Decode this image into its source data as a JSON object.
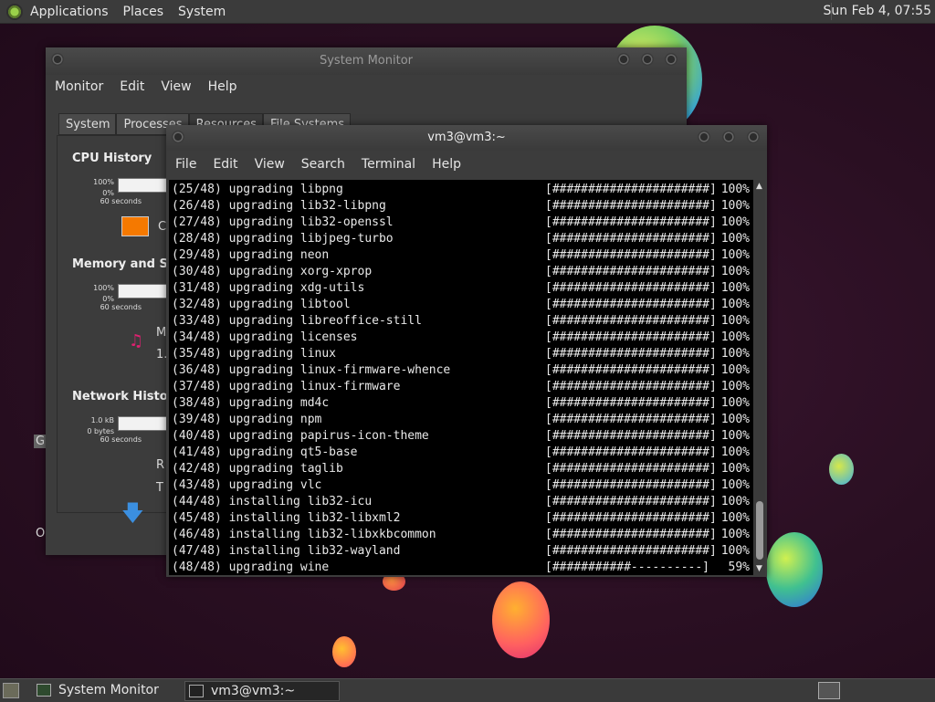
{
  "top_panel": {
    "menus": [
      "Applications",
      "Places",
      "System"
    ],
    "clock": "Sun Feb  4, 07:55"
  },
  "system_monitor": {
    "title": "System Monitor",
    "menu": [
      "Monitor",
      "Edit",
      "View",
      "Help"
    ],
    "tabs": [
      "System",
      "Processes",
      "Resources",
      "File Systems"
    ],
    "active_tab": "Resources",
    "cpu": {
      "title": "CPU History",
      "y_max": "100%",
      "y_min": "0%",
      "x": "60 seconds",
      "label_fragment": "C",
      "swatch_color": "#f57900"
    },
    "memory": {
      "title": "Memory and Swa",
      "y_max": "100%",
      "y_min": "0%",
      "x": "60 seconds",
      "label_fragment": "M",
      "value_fragment": "1."
    },
    "network": {
      "title": "Network History",
      "y_max": "1.0 kB",
      "y_min": "0 bytes",
      "x": "60 seconds",
      "label_fragment": "R",
      "value_fragment": "T"
    }
  },
  "terminal": {
    "title": "vm3@vm3:~",
    "menu": [
      "File",
      "Edit",
      "View",
      "Search",
      "Terminal",
      "Help"
    ],
    "lines": [
      {
        "text": "(25/48) upgrading libpng",
        "bar": "[######################]",
        "pct": "100%"
      },
      {
        "text": "(26/48) upgrading lib32-libpng",
        "bar": "[######################]",
        "pct": "100%"
      },
      {
        "text": "(27/48) upgrading lib32-openssl",
        "bar": "[######################]",
        "pct": "100%"
      },
      {
        "text": "(28/48) upgrading libjpeg-turbo",
        "bar": "[######################]",
        "pct": "100%"
      },
      {
        "text": "(29/48) upgrading neon",
        "bar": "[######################]",
        "pct": "100%"
      },
      {
        "text": "(30/48) upgrading xorg-xprop",
        "bar": "[######################]",
        "pct": "100%"
      },
      {
        "text": "(31/48) upgrading xdg-utils",
        "bar": "[######################]",
        "pct": "100%"
      },
      {
        "text": "(32/48) upgrading libtool",
        "bar": "[######################]",
        "pct": "100%"
      },
      {
        "text": "(33/48) upgrading libreoffice-still",
        "bar": "[######################]",
        "pct": "100%"
      },
      {
        "text": "(34/48) upgrading licenses",
        "bar": "[######################]",
        "pct": "100%"
      },
      {
        "text": "(35/48) upgrading linux",
        "bar": "[######################]",
        "pct": "100%"
      },
      {
        "text": "(36/48) upgrading linux-firmware-whence",
        "bar": "[######################]",
        "pct": "100%"
      },
      {
        "text": "(37/48) upgrading linux-firmware",
        "bar": "[######################]",
        "pct": "100%"
      },
      {
        "text": "(38/48) upgrading md4c",
        "bar": "[######################]",
        "pct": "100%"
      },
      {
        "text": "(39/48) upgrading npm",
        "bar": "[######################]",
        "pct": "100%"
      },
      {
        "text": "(40/48) upgrading papirus-icon-theme",
        "bar": "[######################]",
        "pct": "100%"
      },
      {
        "text": "(41/48) upgrading qt5-base",
        "bar": "[######################]",
        "pct": "100%"
      },
      {
        "text": "(42/48) upgrading taglib",
        "bar": "[######################]",
        "pct": "100%"
      },
      {
        "text": "(43/48) upgrading vlc",
        "bar": "[######################]",
        "pct": "100%"
      },
      {
        "text": "(44/48) installing lib32-icu",
        "bar": "[######################]",
        "pct": "100%"
      },
      {
        "text": "(45/48) installing lib32-libxml2",
        "bar": "[######################]",
        "pct": "100%"
      },
      {
        "text": "(46/48) installing lib32-libxkbcommon",
        "bar": "[######################]",
        "pct": "100%"
      },
      {
        "text": "(47/48) installing lib32-wayland",
        "bar": "[######################]",
        "pct": "100%"
      },
      {
        "text": "(48/48) upgrading wine",
        "bar": "[###########----------]",
        "pct": "59%"
      }
    ]
  },
  "taskbar": {
    "tasks": [
      "System Monitor",
      "vm3@vm3:~"
    ]
  },
  "desktop_fragments": {
    "left_letter_1": "G",
    "left_letter_2": "O"
  }
}
